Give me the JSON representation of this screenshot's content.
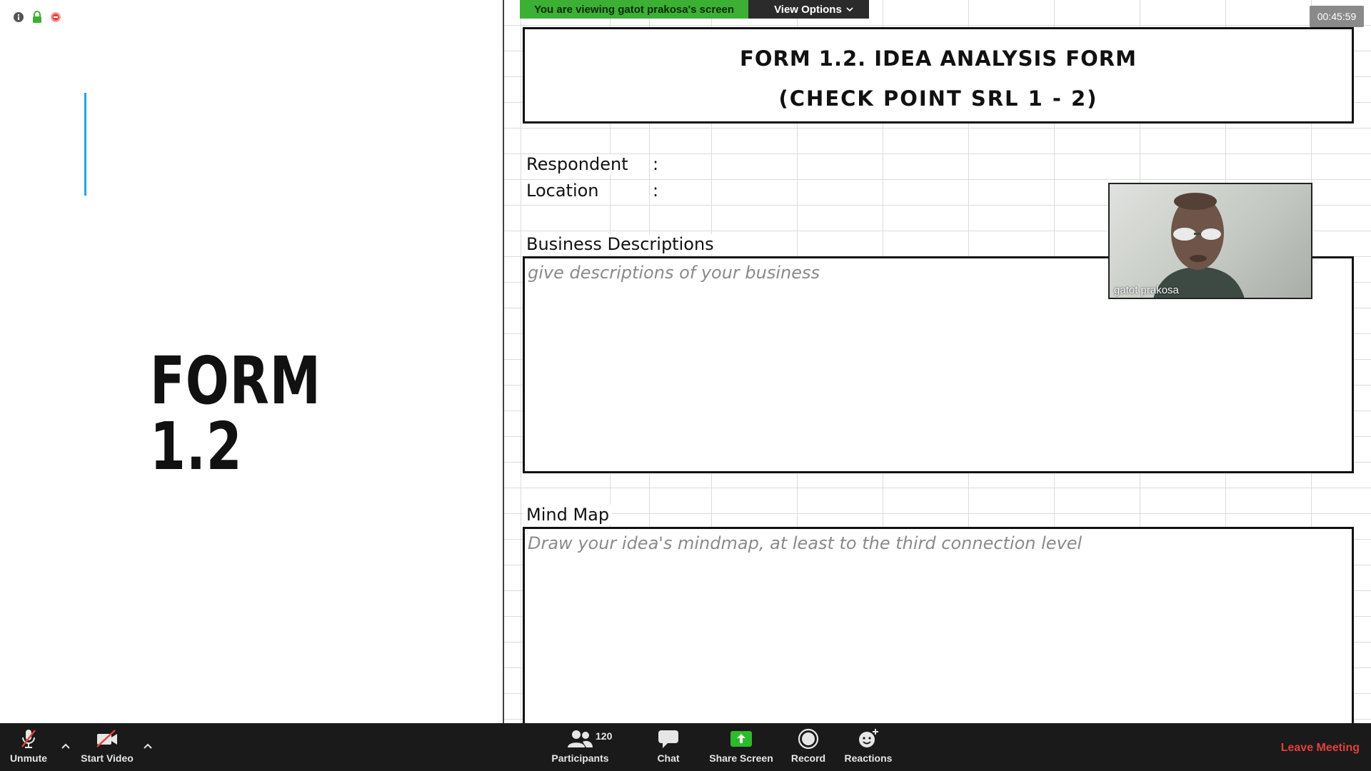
{
  "banner": {
    "message": "You are viewing gatot prakosa's screen",
    "view_options": "View Options"
  },
  "timer": "00:45:59",
  "slide": {
    "title": "FORM 1.2",
    "accent_color": "#2aa3df"
  },
  "form": {
    "title_line1": "FORM 1.2. IDEA ANALYSIS FORM",
    "title_line2": "(CHECK POINT SRL 1 - 2)",
    "respondent_label": "Respondent",
    "location_label": "Location",
    "colon": ":",
    "business_label": "Business Descriptions",
    "business_hint": "give descriptions of your business",
    "mindmap_label": "Mind Map",
    "mindmap_hint": "Draw your idea's mindmap, at least to the third connection level"
  },
  "video": {
    "participant_name": "gatot prakosa"
  },
  "toolbar": {
    "unmute": "Unmute",
    "start_video": "Start Video",
    "participants": "Participants",
    "participants_count": "120",
    "chat": "Chat",
    "share_screen": "Share Screen",
    "record": "Record",
    "reactions": "Reactions",
    "leave": "Leave Meeting",
    "share_color": "#2dbb2d",
    "leave_color": "#e0413b"
  },
  "icons": {
    "info": "info-icon",
    "lock": "lock-icon",
    "recording": "recording-icon"
  }
}
